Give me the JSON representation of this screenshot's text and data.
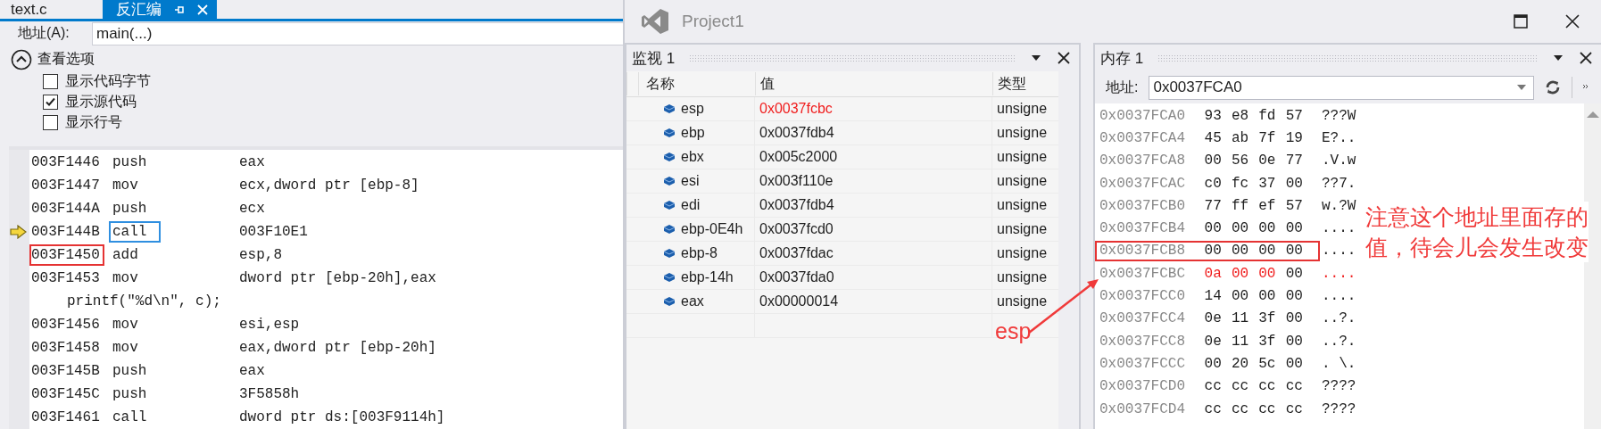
{
  "editor": {
    "tabs": [
      {
        "label": "text.c",
        "selected": false
      },
      {
        "label": "反汇编",
        "selected": true
      }
    ],
    "address_label": "地址(A):",
    "address_value": "main(...)",
    "options": {
      "title": "查看选项",
      "expanded": true,
      "items": [
        {
          "label": "显示代码字节",
          "checked": false
        },
        {
          "label": "显示源代码",
          "checked": true
        },
        {
          "label": "显示行号",
          "checked": false
        }
      ]
    },
    "lines": [
      {
        "kind": "asm",
        "address": "003F1446",
        "mnemonic": "push",
        "operand": "eax",
        "current": false,
        "address_boxed": false,
        "mnemonic_boxed": false
      },
      {
        "kind": "asm",
        "address": "003F1447",
        "mnemonic": "mov",
        "operand": "ecx,dword ptr [ebp-8]",
        "current": false,
        "address_boxed": false,
        "mnemonic_boxed": false
      },
      {
        "kind": "asm",
        "address": "003F144A",
        "mnemonic": "push",
        "operand": "ecx",
        "current": false,
        "address_boxed": false,
        "mnemonic_boxed": false
      },
      {
        "kind": "asm",
        "address": "003F144B",
        "mnemonic": "call",
        "operand": "003F10E1",
        "current": true,
        "address_boxed": false,
        "mnemonic_boxed": true
      },
      {
        "kind": "asm",
        "address": "003F1450",
        "mnemonic": "add",
        "operand": "esp,8",
        "current": false,
        "address_boxed": true,
        "mnemonic_boxed": false
      },
      {
        "kind": "asm",
        "address": "003F1453",
        "mnemonic": "mov",
        "operand": "dword ptr [ebp-20h],eax",
        "current": false,
        "address_boxed": false,
        "mnemonic_boxed": false
      },
      {
        "kind": "source",
        "text": "printf(\"%d\\n\", c);"
      },
      {
        "kind": "asm",
        "address": "003F1456",
        "mnemonic": "mov",
        "operand": "esi,esp",
        "current": false,
        "address_boxed": false,
        "mnemonic_boxed": false
      },
      {
        "kind": "asm",
        "address": "003F1458",
        "mnemonic": "mov",
        "operand": "eax,dword ptr [ebp-20h]",
        "current": false,
        "address_boxed": false,
        "mnemonic_boxed": false
      },
      {
        "kind": "asm",
        "address": "003F145B",
        "mnemonic": "push",
        "operand": "eax",
        "current": false,
        "address_boxed": false,
        "mnemonic_boxed": false
      },
      {
        "kind": "asm",
        "address": "003F145C",
        "mnemonic": "push",
        "operand": "3F5858h",
        "current": false,
        "address_boxed": false,
        "mnemonic_boxed": false
      },
      {
        "kind": "asm",
        "address": "003F1461",
        "mnemonic": "call",
        "operand": "dword ptr ds:[003F9114h]",
        "current": false,
        "address_boxed": false,
        "mnemonic_boxed": false
      }
    ]
  },
  "window": {
    "title": "Project1"
  },
  "watch": {
    "title": "监视 1",
    "columns": [
      "名称",
      "值",
      "类型"
    ],
    "rows": [
      {
        "name": "esp",
        "value": "0x0037fcbc",
        "type": "unsigne",
        "changed": true
      },
      {
        "name": "ebp",
        "value": "0x0037fdb4",
        "type": "unsigne",
        "changed": false
      },
      {
        "name": "ebx",
        "value": "0x005c2000",
        "type": "unsigne",
        "changed": false
      },
      {
        "name": "esi",
        "value": "0x003f110e",
        "type": "unsigne",
        "changed": false
      },
      {
        "name": "edi",
        "value": "0x0037fdb4",
        "type": "unsigne",
        "changed": false
      },
      {
        "name": "ebp-0E4h",
        "value": "0x0037fcd0",
        "type": "unsigne",
        "changed": false
      },
      {
        "name": "ebp-8",
        "value": "0x0037fdac",
        "type": "unsigne",
        "changed": false
      },
      {
        "name": "ebp-14h",
        "value": "0x0037fda0",
        "type": "unsigne",
        "changed": false
      },
      {
        "name": "eax",
        "value": "0x00000014",
        "type": "unsigne",
        "changed": false
      }
    ]
  },
  "memory": {
    "title": "内存 1",
    "address_label": "地址:",
    "address_value": "0x0037FCA0",
    "rows": [
      {
        "address": "0x0037FCA0",
        "bytes": [
          {
            "text": "93",
            "changed": false
          },
          {
            "text": "e8",
            "changed": false
          },
          {
            "text": "fd",
            "changed": false
          },
          {
            "text": "57",
            "changed": false
          }
        ],
        "ascii": "???W",
        "ascii_changed": false,
        "boxed": false
      },
      {
        "address": "0x0037FCA4",
        "bytes": [
          {
            "text": "45",
            "changed": false
          },
          {
            "text": "ab",
            "changed": false
          },
          {
            "text": "7f",
            "changed": false
          },
          {
            "text": "19",
            "changed": false
          }
        ],
        "ascii": "E?..",
        "ascii_changed": false,
        "boxed": false
      },
      {
        "address": "0x0037FCA8",
        "bytes": [
          {
            "text": "00",
            "changed": false
          },
          {
            "text": "56",
            "changed": false
          },
          {
            "text": "0e",
            "changed": false
          },
          {
            "text": "77",
            "changed": false
          }
        ],
        "ascii": ".V.w",
        "ascii_changed": false,
        "boxed": false
      },
      {
        "address": "0x0037FCAC",
        "bytes": [
          {
            "text": "c0",
            "changed": false
          },
          {
            "text": "fc",
            "changed": false
          },
          {
            "text": "37",
            "changed": false
          },
          {
            "text": "00",
            "changed": false
          }
        ],
        "ascii": "??7.",
        "ascii_changed": false,
        "boxed": false
      },
      {
        "address": "0x0037FCB0",
        "bytes": [
          {
            "text": "77",
            "changed": false
          },
          {
            "text": "ff",
            "changed": false
          },
          {
            "text": "ef",
            "changed": false
          },
          {
            "text": "57",
            "changed": false
          }
        ],
        "ascii": "w.?W",
        "ascii_changed": false,
        "boxed": false
      },
      {
        "address": "0x0037FCB4",
        "bytes": [
          {
            "text": "00",
            "changed": false
          },
          {
            "text": "00",
            "changed": false
          },
          {
            "text": "00",
            "changed": false
          },
          {
            "text": "00",
            "changed": false
          }
        ],
        "ascii": "....",
        "ascii_changed": false,
        "boxed": false
      },
      {
        "address": "0x0037FCB8",
        "bytes": [
          {
            "text": "00",
            "changed": false
          },
          {
            "text": "00",
            "changed": false
          },
          {
            "text": "00",
            "changed": false
          },
          {
            "text": "00",
            "changed": false
          }
        ],
        "ascii": "....",
        "ascii_changed": false,
        "boxed": true
      },
      {
        "address": "0x0037FCBC",
        "bytes": [
          {
            "text": "0a",
            "changed": true
          },
          {
            "text": "00",
            "changed": true
          },
          {
            "text": "00",
            "changed": true
          },
          {
            "text": "00",
            "changed": false
          }
        ],
        "ascii": "....",
        "ascii_changed": true,
        "boxed": false
      },
      {
        "address": "0x0037FCC0",
        "bytes": [
          {
            "text": "14",
            "changed": false
          },
          {
            "text": "00",
            "changed": false
          },
          {
            "text": "00",
            "changed": false
          },
          {
            "text": "00",
            "changed": false
          }
        ],
        "ascii": "....",
        "ascii_changed": false,
        "boxed": false
      },
      {
        "address": "0x0037FCC4",
        "bytes": [
          {
            "text": "0e",
            "changed": false
          },
          {
            "text": "11",
            "changed": false
          },
          {
            "text": "3f",
            "changed": false
          },
          {
            "text": "00",
            "changed": false
          }
        ],
        "ascii": "..?.",
        "ascii_changed": false,
        "boxed": false
      },
      {
        "address": "0x0037FCC8",
        "bytes": [
          {
            "text": "0e",
            "changed": false
          },
          {
            "text": "11",
            "changed": false
          },
          {
            "text": "3f",
            "changed": false
          },
          {
            "text": "00",
            "changed": false
          }
        ],
        "ascii": "..?.",
        "ascii_changed": false,
        "boxed": false
      },
      {
        "address": "0x0037FCCC",
        "bytes": [
          {
            "text": "00",
            "changed": false
          },
          {
            "text": "20",
            "changed": false
          },
          {
            "text": "5c",
            "changed": false
          },
          {
            "text": "00",
            "changed": false
          }
        ],
        "ascii": ". \\.",
        "ascii_changed": false,
        "boxed": false
      },
      {
        "address": "0x0037FCD0",
        "bytes": [
          {
            "text": "cc",
            "changed": false
          },
          {
            "text": "cc",
            "changed": false
          },
          {
            "text": "cc",
            "changed": false
          },
          {
            "text": "cc",
            "changed": false
          }
        ],
        "ascii": "????",
        "ascii_changed": false,
        "boxed": false
      },
      {
        "address": "0x0037FCD4",
        "bytes": [
          {
            "text": "cc",
            "changed": false
          },
          {
            "text": "cc",
            "changed": false
          },
          {
            "text": "cc",
            "changed": false
          },
          {
            "text": "cc",
            "changed": false
          }
        ],
        "ascii": "????",
        "ascii_changed": false,
        "boxed": false
      }
    ]
  },
  "annotations": {
    "note": "注意这个地址里面存的值，待会儿会发生改变",
    "arrow_label": "esp"
  }
}
